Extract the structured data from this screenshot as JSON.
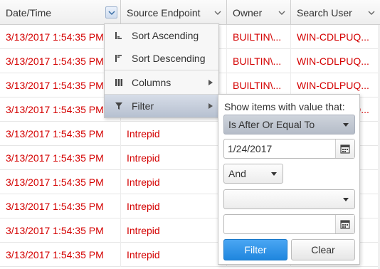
{
  "columns": [
    {
      "label": "Date/Time",
      "menu_open": true
    },
    {
      "label": "Source Endpoint"
    },
    {
      "label": "Owner"
    },
    {
      "label": "Search User"
    }
  ],
  "rows": [
    {
      "datetime": "3/13/2017 1:54:35 PM",
      "source": "",
      "owner": "BUILTIN\\...",
      "user": "WIN-CDLPUQ..."
    },
    {
      "datetime": "3/13/2017 1:54:35 PM",
      "source": "",
      "owner": "BUILTIN\\...",
      "user": "WIN-CDLPUQ..."
    },
    {
      "datetime": "3/13/2017 1:54:35 PM",
      "source": "",
      "owner": "BUILTIN\\...",
      "user": "WIN-CDLPUQ..."
    },
    {
      "datetime": "3/13/2017 1:54:35 PM",
      "source": "",
      "owner": "",
      "user": "WIN-CDLPUQ..."
    },
    {
      "datetime": "3/13/2017 1:54:35 PM",
      "source": "Intrepid",
      "owner": "",
      "user": ""
    },
    {
      "datetime": "3/13/2017 1:54:35 PM",
      "source": "Intrepid",
      "owner": "",
      "user": ""
    },
    {
      "datetime": "3/13/2017 1:54:35 PM",
      "source": "Intrepid",
      "owner": "",
      "user": ""
    },
    {
      "datetime": "3/13/2017 1:54:35 PM",
      "source": "Intrepid",
      "owner": "",
      "user": ""
    },
    {
      "datetime": "3/13/2017 1:54:35 PM",
      "source": "Intrepid",
      "owner": "",
      "user": ""
    },
    {
      "datetime": "3/13/2017 1:54:35 PM",
      "source": "Intrepid",
      "owner": "",
      "user": ""
    }
  ],
  "column_menu": {
    "items": [
      {
        "label": "Sort Ascending",
        "icon": "sort-ascending-icon"
      },
      {
        "label": "Sort Descending",
        "icon": "sort-descending-icon"
      },
      {
        "label": "Columns",
        "icon": "columns-icon",
        "submenu": true
      },
      {
        "label": "Filter",
        "icon": "filter-icon",
        "submenu": true,
        "selected": true
      }
    ]
  },
  "filter": {
    "caption": "Show items with value that:",
    "operator1": "Is After Or Equal To",
    "value1": "1/24/2017",
    "logic": "And",
    "operator2": "",
    "value2": "",
    "filter_button": "Filter",
    "clear_button": "Clear"
  },
  "colors": {
    "row_text": "#d40000",
    "primary_button": "#1f86de",
    "menu_selected": "#b6c0d0"
  }
}
